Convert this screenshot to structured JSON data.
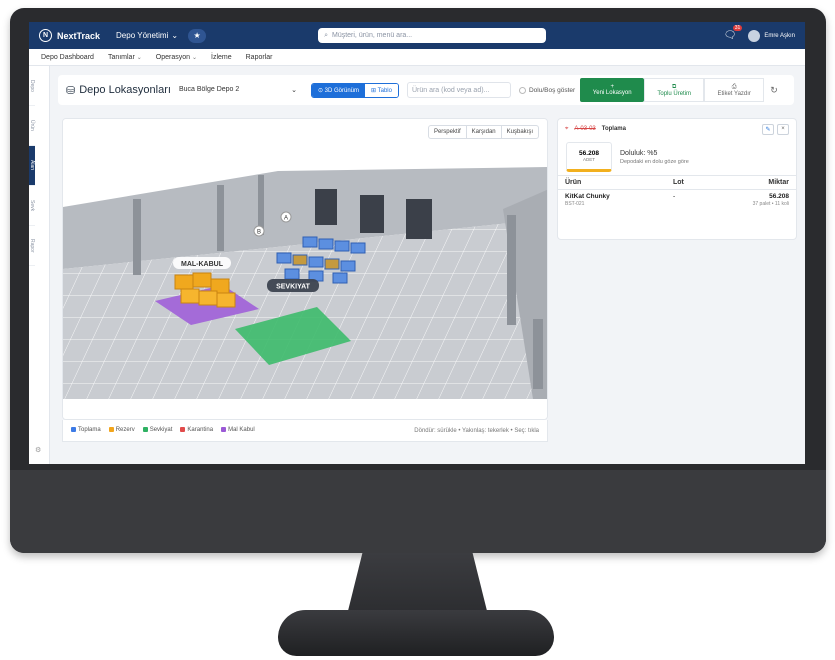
{
  "topbar": {
    "brand": "NextTrack",
    "menu": "Depo Yönetimi",
    "search_placeholder": "Müşteri, ürün, menü ara...",
    "notification_count": "31",
    "user_name": "Emre Aşkın"
  },
  "navbar": {
    "items": [
      "Depo Dashboard",
      "Tanımlar",
      "Operasyon",
      "İzleme",
      "Raporlar"
    ]
  },
  "sidebar": {
    "items": [
      "Depo",
      "Ürün",
      "Alan",
      "Sevk",
      "Rapor"
    ],
    "active_index": 2
  },
  "page": {
    "title": "Depo Lokasyonları",
    "warehouse": "Buca Bölge Depo 2",
    "view_3d": "3D Görünüm",
    "view_table": "Tablo",
    "product_search_placeholder": "Ürün ara (kod veya ad)...",
    "show_filled": "Dolu/Boş göster",
    "btn_new": "Yeni Lokasyon",
    "btn_bulk": "Toplu Üretim",
    "btn_label": "Etiket Yazdır"
  },
  "view3d": {
    "camera": [
      "Perspektif",
      "Karşıdan",
      "Kuşbakışı"
    ],
    "zones": {
      "receiving": "MAL-KABUL",
      "shipping": "SEVKIYAT",
      "marker_a": "A",
      "marker_b": "B"
    }
  },
  "legend": {
    "items": [
      {
        "label": "Toplama",
        "color": "#3d7be6"
      },
      {
        "label": "Rezerv",
        "color": "#f2a51c"
      },
      {
        "label": "Sevkiyat",
        "color": "#2fb163"
      },
      {
        "label": "Karantina",
        "color": "#e14b4b"
      },
      {
        "label": "Mal Kabul",
        "color": "#9b59d6"
      }
    ],
    "hint": "Döndür: sürükle • Yakınlaş: tekerlek • Seç: tıkla"
  },
  "detail": {
    "code": "A-03-03",
    "type": "Toplama",
    "stat_value": "56.208",
    "stat_unit": "ADET",
    "fill_title": "Doluluk: %5",
    "fill_sub": "Depodaki en dolu göze göre",
    "columns": [
      "Ürün",
      "Lot",
      "Miktar"
    ],
    "rows": [
      {
        "product": "KitKat Chunky",
        "sku": "BST-021",
        "lot": "-",
        "qty": "56.208",
        "qty_sub": "37 palet • 11 koli"
      }
    ]
  }
}
